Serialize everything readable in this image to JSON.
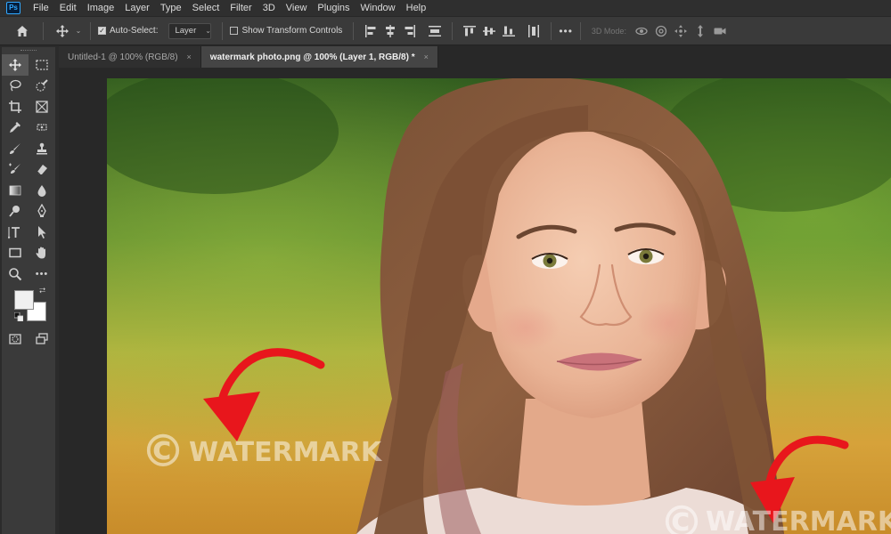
{
  "app": {
    "logo_text": "Ps"
  },
  "menu": [
    "File",
    "Edit",
    "Image",
    "Layer",
    "Type",
    "Select",
    "Filter",
    "3D",
    "View",
    "Plugins",
    "Window",
    "Help"
  ],
  "options": {
    "auto_select_label": "Auto-Select:",
    "auto_select_checked": true,
    "layer_dropdown": "Layer",
    "show_transform_label": "Show Transform Controls",
    "show_transform_checked": false,
    "more_label": "•••",
    "mode_3d_label": "3D Mode:"
  },
  "tabs": [
    {
      "label": "Untitled-1 @ 100% (RGB/8)",
      "active": false,
      "close": "×"
    },
    {
      "label": "watermark photo.png @ 100% (Layer 1, RGB/8) *",
      "active": true,
      "close": "×"
    }
  ],
  "tools": {
    "active": "move-tool",
    "more_label": "•••"
  },
  "swatches": {
    "foreground": "#f0f0f0",
    "background": "#ffffff"
  },
  "photo": {
    "watermarks": [
      {
        "symbol": "©",
        "text": "WATERMARK"
      },
      {
        "symbol": "©",
        "text": "WATERMARK"
      }
    ],
    "arrow_color": "#e8161c"
  },
  "colors": {
    "menubar": "#2f2f2f",
    "options_bar": "#3a3a3a",
    "panel": "#3a3a3a",
    "workspace": "#282828",
    "active_tab": "#454545"
  }
}
